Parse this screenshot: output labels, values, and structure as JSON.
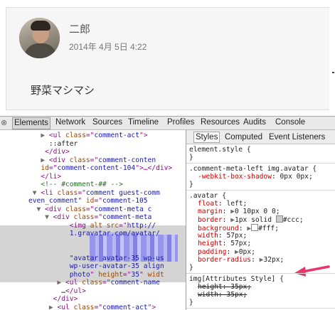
{
  "preview": {
    "author": "二郎",
    "date": "2014年 4月 5日 4:22",
    "body": "野菜マシマシ"
  },
  "toolbar": {
    "close": "⊗",
    "tabs": [
      "Elements",
      "Network",
      "Sources",
      "Timeline",
      "Profiles",
      "Resources",
      "Audits",
      "Console"
    ]
  },
  "elements": {
    "lines": [
      {
        "indent": "   ▶ ",
        "parts": [
          [
            "tag",
            "<ul "
          ],
          [
            "attr",
            "class"
          ],
          [
            "tag",
            "=\""
          ],
          [
            "val",
            "comment-act"
          ],
          [
            "tag",
            "\">"
          ]
        ]
      },
      {
        "indent": "     ",
        "parts": [
          [
            "txt",
            "::after"
          ]
        ]
      },
      {
        "indent": "    ",
        "parts": [
          [
            "tag",
            "</div>"
          ]
        ]
      },
      {
        "indent": "   ▶ ",
        "parts": [
          [
            "tag",
            "<div "
          ],
          [
            "attr",
            "class"
          ],
          [
            "tag",
            "=\""
          ],
          [
            "val",
            "comment-conten"
          ]
        ]
      },
      {
        "indent": "   ",
        "parts": [
          [
            "attr",
            "id"
          ],
          [
            "tag",
            "=\""
          ],
          [
            "val",
            "comment-content-104"
          ],
          [
            "tag",
            "\">…</div>"
          ]
        ]
      },
      {
        "indent": "   ",
        "parts": [
          [
            "tag",
            "</li>"
          ]
        ]
      },
      {
        "indent": "   ",
        "parts": [
          [
            "cmt",
            "<!-- #comment-## -->"
          ]
        ]
      },
      {
        "indent": " ▼ ",
        "parts": [
          [
            "tag",
            "<li "
          ],
          [
            "attr",
            "class"
          ],
          [
            "tag",
            "=\""
          ],
          [
            "val",
            "comment guest-comm"
          ]
        ]
      },
      {
        "indent": "",
        "parts": [
          [
            "val",
            "even_comment"
          ],
          [
            "tag",
            "\" "
          ],
          [
            "attr",
            "id"
          ],
          [
            "tag",
            "=\""
          ],
          [
            "val",
            "comment-105"
          ]
        ]
      },
      {
        "indent": "  ▼ ",
        "parts": [
          [
            "tag",
            "<div "
          ],
          [
            "attr",
            "class"
          ],
          [
            "tag",
            "=\""
          ],
          [
            "val",
            "comment-meta c"
          ]
        ]
      },
      {
        "indent": "    ▼ ",
        "parts": [
          [
            "tag",
            "<div "
          ],
          [
            "attr",
            "class"
          ],
          [
            "tag",
            "=\""
          ],
          [
            "val",
            "comment-meta"
          ]
        ]
      },
      {
        "indent": "          ",
        "parts": [
          [
            "tag",
            "<img "
          ],
          [
            "attr",
            "alt src"
          ],
          [
            "tag",
            "=\""
          ],
          [
            "val",
            "http://"
          ]
        ]
      },
      {
        "indent": "          ",
        "parts": [
          [
            "val",
            "1.gravatar.com/avatar/"
          ]
        ]
      },
      {
        "indent": "",
        "parts": []
      },
      {
        "indent": "",
        "parts": []
      },
      {
        "indent": "          ",
        "parts": [
          [
            "val",
            "\"avatar avatar-35 wp-us"
          ]
        ]
      },
      {
        "indent": "          ",
        "parts": [
          [
            "val",
            "wp-user-avatar-35 align"
          ]
        ]
      },
      {
        "indent": "          ",
        "parts": [
          [
            "val",
            "photo"
          ],
          [
            "tag",
            "\" "
          ],
          [
            "attr",
            "height"
          ],
          [
            "tag",
            "=\""
          ],
          [
            "val",
            "35"
          ],
          [
            "tag",
            "\" "
          ],
          [
            "attr",
            "widt"
          ]
        ]
      },
      {
        "indent": "       ▶ ",
        "parts": [
          [
            "tag",
            "<ul "
          ],
          [
            "attr",
            "class"
          ],
          [
            "tag",
            "=\""
          ],
          [
            "val",
            "comment-name"
          ]
        ]
      },
      {
        "indent": "        ",
        "parts": [
          [
            "txt",
            "…"
          ],
          [
            "tag",
            "</ul>"
          ]
        ]
      },
      {
        "indent": "      ",
        "parts": [
          [
            "tag",
            "</div>"
          ]
        ]
      },
      {
        "indent": "     ▶ ",
        "parts": [
          [
            "tag",
            "<ul "
          ],
          [
            "attr",
            "class"
          ],
          [
            "tag",
            "=\""
          ],
          [
            "val",
            "comment-act"
          ],
          [
            "tag",
            "\">"
          ]
        ]
      }
    ]
  },
  "styles": {
    "tabs": [
      "Styles",
      "Computed",
      "Event Listeners"
    ],
    "rules": [
      {
        "selector": "element.style {",
        "decls": [],
        "close": "}"
      },
      {
        "selector": ".comment-meta-left img.avatar {",
        "decls": [
          {
            "prop": "-webkit-box-shadow",
            "value": "0px 0px;",
            "arrow": false,
            "strike": false
          }
        ],
        "close": "}"
      },
      {
        "selector": ".avatar {",
        "decls": [
          {
            "prop": "float",
            "value": "left;",
            "arrow": false,
            "strike": false
          },
          {
            "prop": "margin",
            "value": "0 10px 0 0;",
            "arrow": true,
            "strike": false
          },
          {
            "prop": "border",
            "value": "1px solid",
            "swatch": "#cccccc",
            "value2": "#ccc;",
            "arrow": true,
            "strike": false
          },
          {
            "prop": "background",
            "value": "",
            "swatch": "#ffffff",
            "value2": "#fff;",
            "arrow": true,
            "strike": false
          },
          {
            "prop": "width",
            "value": "57px;",
            "arrow": false,
            "strike": false
          },
          {
            "prop": "height",
            "value": "57px;",
            "arrow": false,
            "strike": false
          },
          {
            "prop": "padding",
            "value": "0px;",
            "arrow": true,
            "strike": false
          },
          {
            "prop": "border-radius",
            "value": "32px;",
            "arrow": true,
            "strike": false
          }
        ],
        "close": "}"
      },
      {
        "selector": "img[Attributes Style] {",
        "decls": [
          {
            "prop": "height",
            "value": "35px;",
            "arrow": false,
            "strike": true
          },
          {
            "prop": "width",
            "value": "35px;",
            "arrow": false,
            "strike": true
          }
        ],
        "close": "}"
      }
    ]
  },
  "colors": {
    "annotation_arrow": "#e8356a",
    "selection": "#d4d4d4"
  }
}
